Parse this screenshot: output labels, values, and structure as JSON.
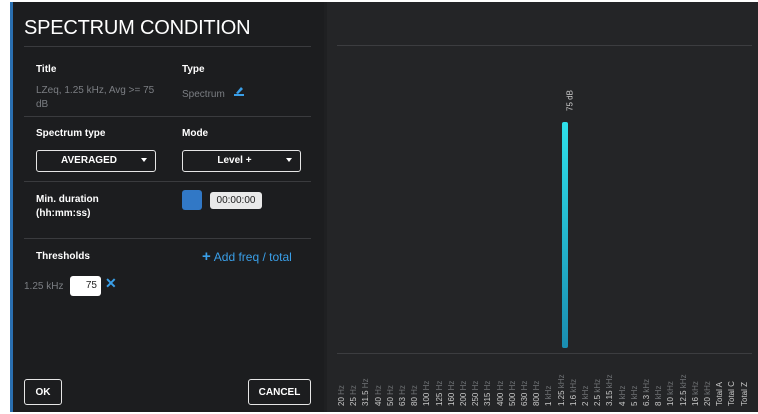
{
  "dialog": {
    "title": "SPECTRUM CONDITION",
    "fields": {
      "title_label": "Title",
      "title_value": "LZeq, 1.25 kHz, Avg >= 75 dB",
      "type_label": "Type",
      "type_value": "Spectrum",
      "spectrum_type_label": "Spectrum type",
      "spectrum_type_value": "AVERAGED",
      "mode_label": "Mode",
      "mode_value": "Level +",
      "min_duration_label": "Min. duration (hh:mm:ss)",
      "min_duration_value": "00:00:00",
      "thresholds_label": "Thresholds",
      "add_freq_label": "Add freq / total",
      "threshold_freq": "1.25 kHz",
      "threshold_value": "75"
    },
    "buttons": {
      "ok": "OK",
      "cancel": "CANCEL"
    },
    "icons": {
      "type": "chart-edit-icon",
      "add": "plus-icon",
      "remove": "close-icon"
    },
    "colors": {
      "accent": "#3178c6",
      "link": "#3a9fe8",
      "bar": "#2ee0ea"
    }
  },
  "chart_data": {
    "type": "bar",
    "categories": [
      "20 Hz",
      "25 Hz",
      "31.5 Hz",
      "40 Hz",
      "50 Hz",
      "63 Hz",
      "80 Hz",
      "100 Hz",
      "125 Hz",
      "160 Hz",
      "200 Hz",
      "250 Hz",
      "315 Hz",
      "400 Hz",
      "500 Hz",
      "630 Hz",
      "800 Hz",
      "1 kHz",
      "1.25 kHz",
      "1.6 kHz",
      "2 kHz",
      "2.5 kHz",
      "3.15 kHz",
      "4 kHz",
      "5 kHz",
      "6.3 kHz",
      "8 kHz",
      "10 kHz",
      "12.5 kHz",
      "16 kHz",
      "20 kHz",
      "Total A",
      "Total C",
      "Total Z"
    ],
    "tick_labels": [
      {
        "n": "20",
        "u": "Hz"
      },
      {
        "n": "25",
        "u": "Hz"
      },
      {
        "n": "31.5",
        "u": "Hz"
      },
      {
        "n": "40",
        "u": "Hz"
      },
      {
        "n": "50",
        "u": "Hz"
      },
      {
        "n": "63",
        "u": "Hz"
      },
      {
        "n": "80",
        "u": "Hz"
      },
      {
        "n": "100",
        "u": "Hz"
      },
      {
        "n": "125",
        "u": "Hz"
      },
      {
        "n": "160",
        "u": "Hz"
      },
      {
        "n": "200",
        "u": "Hz"
      },
      {
        "n": "250",
        "u": "Hz"
      },
      {
        "n": "315",
        "u": "Hz"
      },
      {
        "n": "400",
        "u": "Hz"
      },
      {
        "n": "500",
        "u": "Hz"
      },
      {
        "n": "630",
        "u": "Hz"
      },
      {
        "n": "800",
        "u": "Hz"
      },
      {
        "n": "1",
        "u": "kHz"
      },
      {
        "n": "1.25",
        "u": "kHz"
      },
      {
        "n": "1.6",
        "u": "kHz"
      },
      {
        "n": "2",
        "u": "kHz"
      },
      {
        "n": "2.5",
        "u": "kHz"
      },
      {
        "n": "3.15",
        "u": "kHz"
      },
      {
        "n": "4",
        "u": "kHz"
      },
      {
        "n": "5",
        "u": "kHz"
      },
      {
        "n": "6.3",
        "u": "kHz"
      },
      {
        "n": "8",
        "u": "kHz"
      },
      {
        "n": "10",
        "u": "kHz"
      },
      {
        "n": "12.5",
        "u": "kHz"
      },
      {
        "n": "16",
        "u": "kHz"
      },
      {
        "n": "20",
        "u": "kHz"
      },
      {
        "n": "Total A",
        "u": ""
      },
      {
        "n": "Total C",
        "u": ""
      },
      {
        "n": "Total Z",
        "u": ""
      }
    ],
    "series": [
      {
        "values": [
          null,
          null,
          null,
          null,
          null,
          null,
          null,
          null,
          null,
          null,
          null,
          null,
          null,
          null,
          null,
          null,
          null,
          null,
          75,
          null,
          null,
          null,
          null,
          null,
          null,
          null,
          null,
          null,
          null,
          null,
          null,
          null,
          null,
          null
        ]
      }
    ],
    "data_labels": [
      "75 dB"
    ],
    "grid": true
  }
}
